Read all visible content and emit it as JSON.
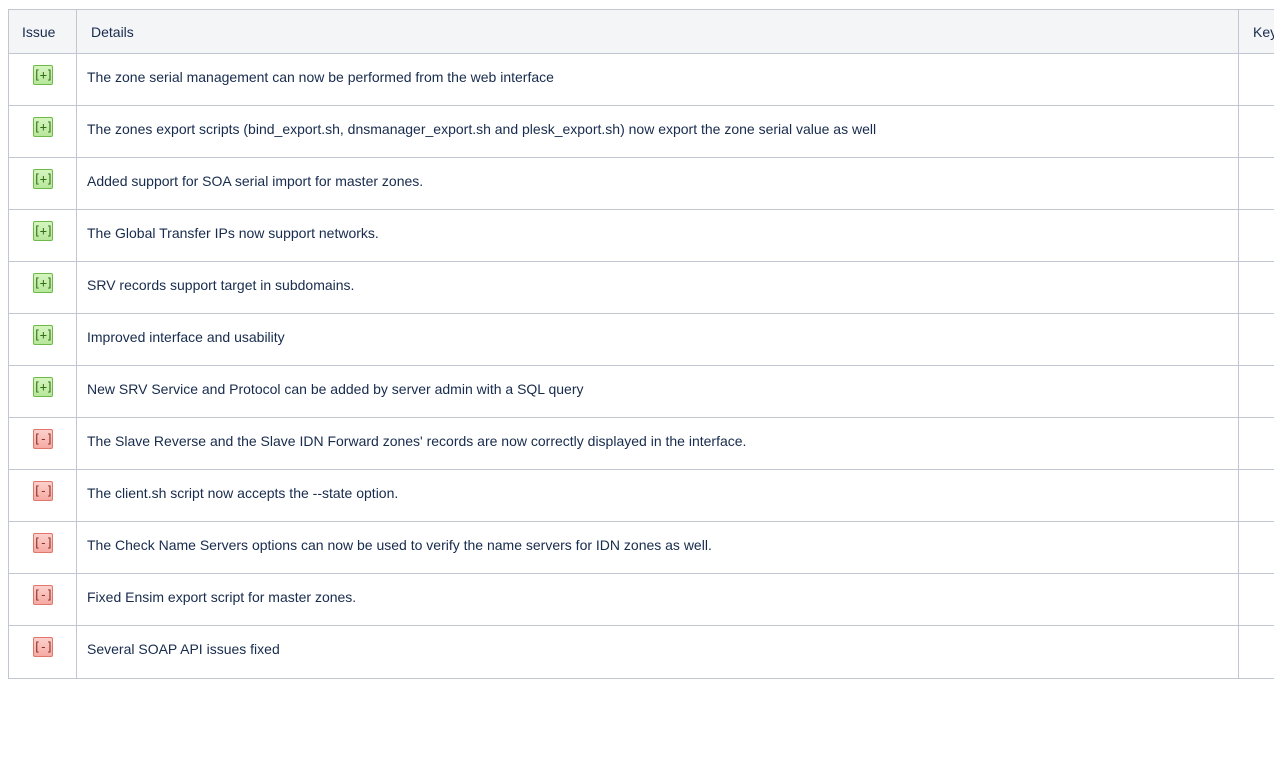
{
  "table": {
    "headers": [
      "Issue",
      "Details",
      "Key"
    ],
    "rows": [
      {
        "type": "add",
        "badge": "[+]",
        "details": "The zone serial management can now be performed from the web interface"
      },
      {
        "type": "add",
        "badge": "[+]",
        "details": "The zones export scripts (bind_export.sh, dnsmanager_export.sh and plesk_export.sh) now export the zone serial value as well"
      },
      {
        "type": "add",
        "badge": "[+]",
        "details": "Added support for SOA serial import for master zones."
      },
      {
        "type": "add",
        "badge": "[+]",
        "details": "The Global Transfer IPs now support networks."
      },
      {
        "type": "add",
        "badge": "[+]",
        "details": "SRV records support target in subdomains."
      },
      {
        "type": "add",
        "badge": "[+]",
        "details": "Improved interface and usability"
      },
      {
        "type": "add",
        "badge": "[+]",
        "details": "New SRV Service and Protocol can be added by server admin with a SQL query"
      },
      {
        "type": "fix",
        "badge": "[-]",
        "details": "The Slave Reverse and the Slave IDN Forward zones' records are now correctly displayed in the interface."
      },
      {
        "type": "fix",
        "badge": "[-]",
        "details": "The client.sh script now accepts the --state option."
      },
      {
        "type": "fix",
        "badge": "[-]",
        "details": "The Check Name Servers options can now be used to verify the name servers for IDN zones as well."
      },
      {
        "type": "fix",
        "badge": "[-]",
        "details": "Fixed Ensim export script for master zones."
      },
      {
        "type": "fix",
        "badge": "[-]",
        "details": "Several SOAP API issues fixed"
      }
    ]
  },
  "colors": {
    "header_bg": "#f4f5f7",
    "border": "#c1c7d0",
    "text": "#172b4d",
    "add_badge_bg": "#c6eeaa",
    "add_badge_border": "#6dbb47",
    "fix_badge_bg": "#f8bcb6",
    "fix_badge_border": "#e0766c"
  },
  "icons": {
    "add": "plus-bracket-icon",
    "fix": "minus-bracket-icon"
  }
}
